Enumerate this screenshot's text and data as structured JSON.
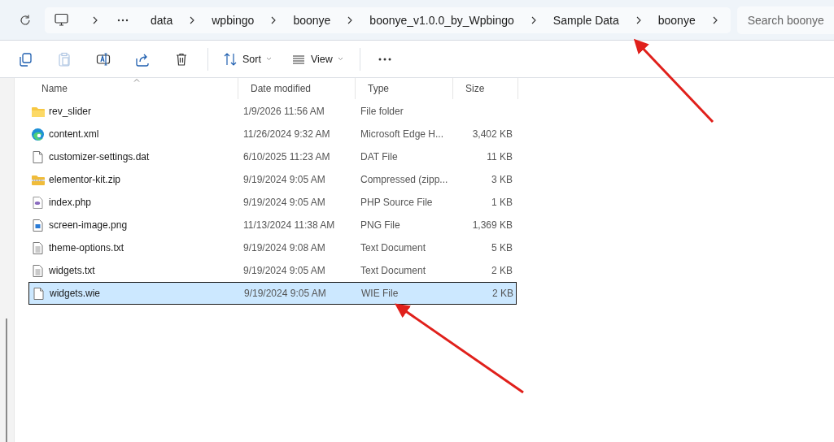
{
  "address_bar": {
    "crumbs": [
      "data",
      "wpbingo",
      "boonye",
      "boonye_v1.0.0_by_Wpbingo",
      "Sample Data",
      "boonye"
    ]
  },
  "search": {
    "placeholder": "Search boonye"
  },
  "toolbar": [
    {
      "kind": "copy",
      "disabled": false
    },
    {
      "kind": "paste",
      "disabled": true
    },
    {
      "kind": "rename",
      "disabled": false
    },
    {
      "kind": "share",
      "disabled": false
    },
    {
      "kind": "delete",
      "disabled": false
    },
    {
      "kind": "sort",
      "label": "Sort",
      "disabled": false
    },
    {
      "kind": "view",
      "label": "View",
      "disabled": false
    },
    {
      "kind": "more",
      "disabled": false
    }
  ],
  "table": {
    "columns": [
      "Name",
      "Date modified",
      "Type",
      "Size"
    ],
    "rows": [
      {
        "kind": "folder",
        "name": "rev_slider",
        "date": "1/9/2026 11:56 AM",
        "type": "File folder",
        "size": "",
        "selected": false
      },
      {
        "kind": "edge",
        "name": "content.xml",
        "date": "11/26/2024 9:32 AM",
        "type": "Microsoft Edge H...",
        "size": "3,402 KB",
        "selected": false
      },
      {
        "kind": "blank",
        "name": "customizer-settings.dat",
        "date": "6/10/2025 11:23 AM",
        "type": "DAT File",
        "size": "11 KB",
        "selected": false
      },
      {
        "kind": "zip",
        "name": "elementor-kit.zip",
        "date": "9/19/2024 9:05 AM",
        "type": "Compressed (zipp...",
        "size": "3 KB",
        "selected": false
      },
      {
        "kind": "php",
        "name": "index.php",
        "date": "9/19/2024 9:05 AM",
        "type": "PHP Source File",
        "size": "1 KB",
        "selected": false
      },
      {
        "kind": "image",
        "name": "screen-image.png",
        "date": "11/13/2024 11:38 AM",
        "type": "PNG File",
        "size": "1,369 KB",
        "selected": false
      },
      {
        "kind": "text",
        "name": "theme-options.txt",
        "date": "9/19/2024 9:08 AM",
        "type": "Text Document",
        "size": "5 KB",
        "selected": false
      },
      {
        "kind": "text",
        "name": "widgets.txt",
        "date": "9/19/2024 9:05 AM",
        "type": "Text Document",
        "size": "2 KB",
        "selected": false
      },
      {
        "kind": "blank",
        "name": "widgets.wie",
        "date": "9/19/2024 9:05 AM",
        "type": "WIE File",
        "size": "2 KB",
        "selected": true
      }
    ]
  },
  "annotations": [
    {
      "kind": "arrow"
    },
    {
      "kind": "arrow"
    }
  ]
}
